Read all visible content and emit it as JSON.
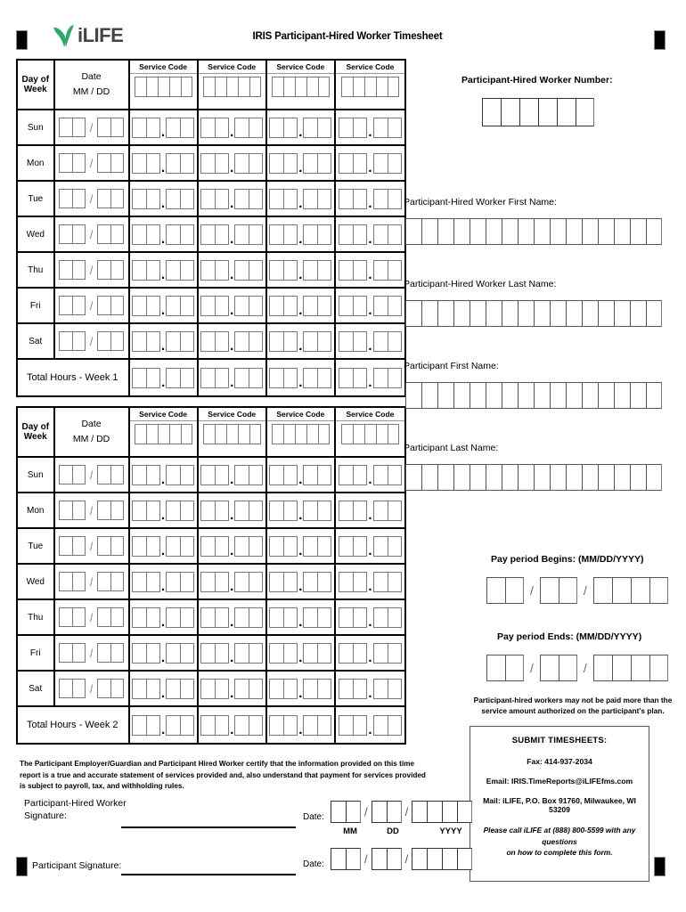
{
  "document": {
    "title": "IRIS Participant-Hired Worker Timesheet",
    "logo_text": "iLIFE",
    "logo_icon": "leaf-icon"
  },
  "timesheet_tables": [
    {
      "id": "week-1",
      "headers": {
        "day_line1": "Day of",
        "day_line2": "Week",
        "date_line1": "Date",
        "date_line2": "MM / DD",
        "service_code_label": "Service Code",
        "service_code_columns": 4,
        "service_code_cells": 5
      },
      "days": [
        "Sun",
        "Mon",
        "Tue",
        "Wed",
        "Thu",
        "Fri",
        "Sat"
      ],
      "total_label": "Total Hours - Week 1"
    },
    {
      "id": "week-2",
      "headers": {
        "day_line1": "Day of",
        "day_line2": "Week",
        "date_line1": "Date",
        "date_line2": "MM / DD",
        "service_code_label": "Service Code",
        "service_code_columns": 4,
        "service_code_cells": 5
      },
      "days": [
        "Sun",
        "Mon",
        "Tue",
        "Wed",
        "Thu",
        "Fri",
        "Sat"
      ],
      "total_label": "Total Hours - Week 2"
    }
  ],
  "right_panel": {
    "worker_number": {
      "label": "Participant-Hired Worker Number:",
      "cells": 6,
      "value": ""
    },
    "fields": [
      {
        "name": "worker-first-name",
        "label": "Participant-Hired Worker First  Name:",
        "cells": 16,
        "value": ""
      },
      {
        "name": "worker-last-name",
        "label": "Participant-Hired Worker Last Name:",
        "cells": 16,
        "value": ""
      },
      {
        "name": "participant-first-name",
        "label": "Participant First Name:",
        "cells": 16,
        "value": ""
      },
      {
        "name": "participant-last-name",
        "label": "Participant Last Name:",
        "cells": 16,
        "value": ""
      }
    ],
    "pay_period": {
      "begins_label": "Pay period Begins: (MM/DD/YYYY)",
      "ends_label": "Pay period Ends: (MM/DD/YYYY)",
      "separator": "/",
      "mm_cells": 2,
      "dd_cells": 2,
      "yyyy_cells": 4
    },
    "note_line1": "Participant-hired workers may not be paid more than the",
    "note_line2": "service amount authorized on the participant's plan."
  },
  "submit_box": {
    "title": "SUBMIT TIMESHEETS:",
    "fax_label": "Fax:",
    "fax_value": "414-937-2034",
    "email_label": "Email:",
    "email_value": "IRIS.TimeReports@iLIFEfms.com",
    "mail_label": "Mail:",
    "mail_value": "iLIFE, P.O. Box 91760, Milwaukee, WI 53209",
    "help_line1": "Please call iLIFE at (888) 800-5599 with any questions",
    "help_line2": "on how to complete this form."
  },
  "certification": {
    "line1": "The Participant Employer/Guardian and Participant Hired Worker certify that the information provided on this time report is a true and accurate",
    "line2": "statement of services provided and, also understand that payment for services provided is subject to payroll, tax, and withholding rules."
  },
  "signatures": {
    "worker_label_line1": "Participant-Hired Worker",
    "worker_label_line2": "Signature:",
    "participant_label": "Participant Signature:",
    "date_label": "Date:",
    "mm_label": "MM",
    "dd_label": "DD",
    "yyyy_label": "YYYY",
    "separator": "/"
  },
  "colors": {
    "brand_green": "#2fa86b",
    "logo_gray": "#444444",
    "rule_black": "#000000"
  }
}
